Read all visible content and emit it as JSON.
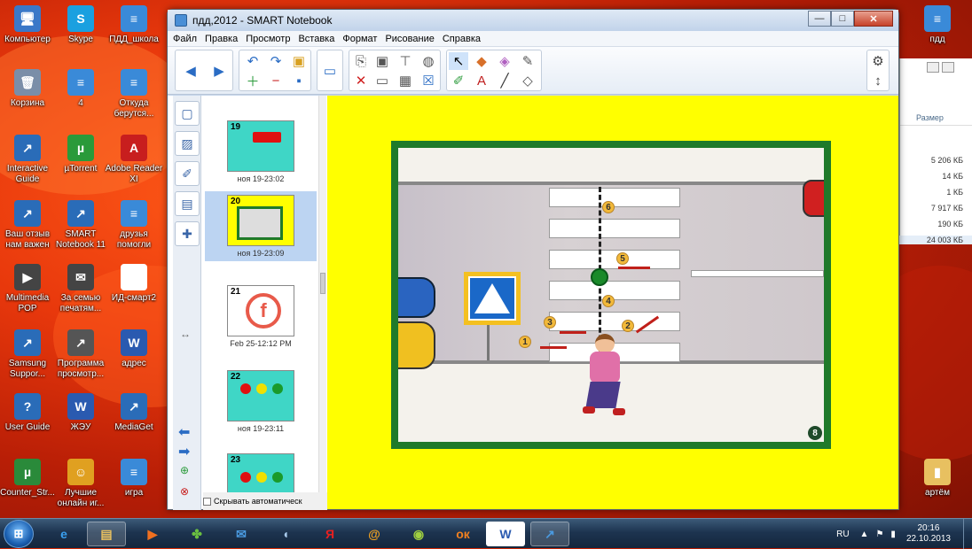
{
  "desktop": {
    "icons_left": [
      {
        "label": "Компьютер",
        "color": "#3a78c8",
        "glyph": "🖥"
      },
      {
        "label": "Корзина",
        "color": "#7a8ea8",
        "glyph": "🗑"
      },
      {
        "label": "Interactive Guide",
        "color": "#2a6cb8",
        "glyph": "↗"
      },
      {
        "label": "Ваш отзыв нам важен",
        "color": "#2a6cb8",
        "glyph": "↗"
      },
      {
        "label": "Multimedia POP",
        "color": "#444444",
        "glyph": "▶"
      },
      {
        "label": "Samsung Suppor...",
        "color": "#2a6cb8",
        "glyph": "↗"
      },
      {
        "label": "User Guide",
        "color": "#2a6cb8",
        "glyph": "?"
      },
      {
        "label": "Counter_Str...",
        "color": "#2a8a3a",
        "glyph": "µ"
      }
    ],
    "icons_col2": [
      {
        "label": "Skype",
        "color": "#1aa0e0",
        "glyph": "S"
      },
      {
        "label": "4",
        "color": "#3a8ad8",
        "glyph": "≡"
      },
      {
        "label": "µTorrent",
        "color": "#2a9a3a",
        "glyph": "µ"
      },
      {
        "label": "SMART Notebook 11",
        "color": "#2a6cb8",
        "glyph": "↗"
      },
      {
        "label": "За семью печатям...",
        "color": "#444444",
        "glyph": "✉"
      },
      {
        "label": "Программа просмотр...",
        "color": "#555555",
        "glyph": "↗"
      },
      {
        "label": "ЖЭУ",
        "color": "#2a5ab0",
        "glyph": "W"
      },
      {
        "label": "Лучшие онлайн иг...",
        "color": "#e0a020",
        "glyph": "☺"
      }
    ],
    "icons_col3": [
      {
        "label": "ПДД_школа",
        "color": "#3a8ad8",
        "glyph": "≡"
      },
      {
        "label": "Откуда берутся...",
        "color": "#3a8ad8",
        "glyph": "≡"
      },
      {
        "label": "Adobe Reader XI",
        "color": "#c81e1e",
        "glyph": "A"
      },
      {
        "label": "друзья помогли",
        "color": "#3a8ad8",
        "glyph": "≡"
      },
      {
        "label": "ИД-смарт2",
        "color": "#ffffff",
        "glyph": "◧"
      },
      {
        "label": "адрес",
        "color": "#2a5ab0",
        "glyph": "W"
      },
      {
        "label": "MediaGet",
        "color": "#2a6cb8",
        "glyph": "↗"
      },
      {
        "label": "игра",
        "color": "#3a8ad8",
        "glyph": "≡"
      }
    ],
    "icons_right": [
      {
        "label": "пдд",
        "color": "#3a8ad8",
        "glyph": "≡"
      },
      {
        "label": "артём",
        "color": "#e8c060",
        "glyph": "▮"
      }
    ]
  },
  "window": {
    "title": "пдд,2012 - SMART Notebook",
    "buttons": {
      "minimize": "—",
      "maximize": "□",
      "close": "✕"
    },
    "menu": [
      "Файл",
      "Правка",
      "Просмотр",
      "Вставка",
      "Формат",
      "Рисование",
      "Справка"
    ]
  },
  "toolbar": {
    "icons": [
      "back-icon",
      "forward-icon",
      "undo-icon",
      "redo-icon",
      "open-icon",
      "add-page-icon",
      "delete-page-icon",
      "save-icon",
      "display-icon",
      "paste-icon",
      "screen-icon",
      "screen-shade-icon",
      "table-icon",
      "delete-icon",
      "select-icon",
      "pen-icon",
      "eraser-icon",
      "fill-icon",
      "creative-pen-icon",
      "text-icon",
      "line-icon",
      "shape-eraser-icon",
      "settings-icon",
      "move-toolbar-icon"
    ]
  },
  "sorter": {
    "pages": [
      {
        "num": "19",
        "caption": "ноя 19-23:02",
        "bg": "#3fd6c6"
      },
      {
        "num": "20",
        "caption": "ноя 19-23:09",
        "bg": "#ffff00",
        "selected": true
      },
      {
        "num": "21",
        "caption": "Feb 25-12:12 PM",
        "bg": "#ffffff"
      },
      {
        "num": "22",
        "caption": "ноя 19-23:11",
        "bg": "#3fd6c6"
      },
      {
        "num": "23",
        "caption": "",
        "bg": "#3fd6c6"
      }
    ],
    "auto_hide_label": "Скрывать автоматическ"
  },
  "canvas": {
    "labels": [
      "1",
      "2",
      "3",
      "4",
      "5",
      "6"
    ],
    "badge": "8",
    "colors": {
      "page": "#ffff00",
      "frame": "#1f7a2a"
    }
  },
  "explorer": {
    "column": "Размер",
    "sizes": [
      "5 206 КБ",
      "14 КБ",
      "1 КБ",
      "7 917 КБ",
      "190 КБ",
      "24 003 КБ"
    ]
  },
  "taskbar": {
    "lang": "RU",
    "time": "20:16",
    "date": "22.10.2013"
  }
}
